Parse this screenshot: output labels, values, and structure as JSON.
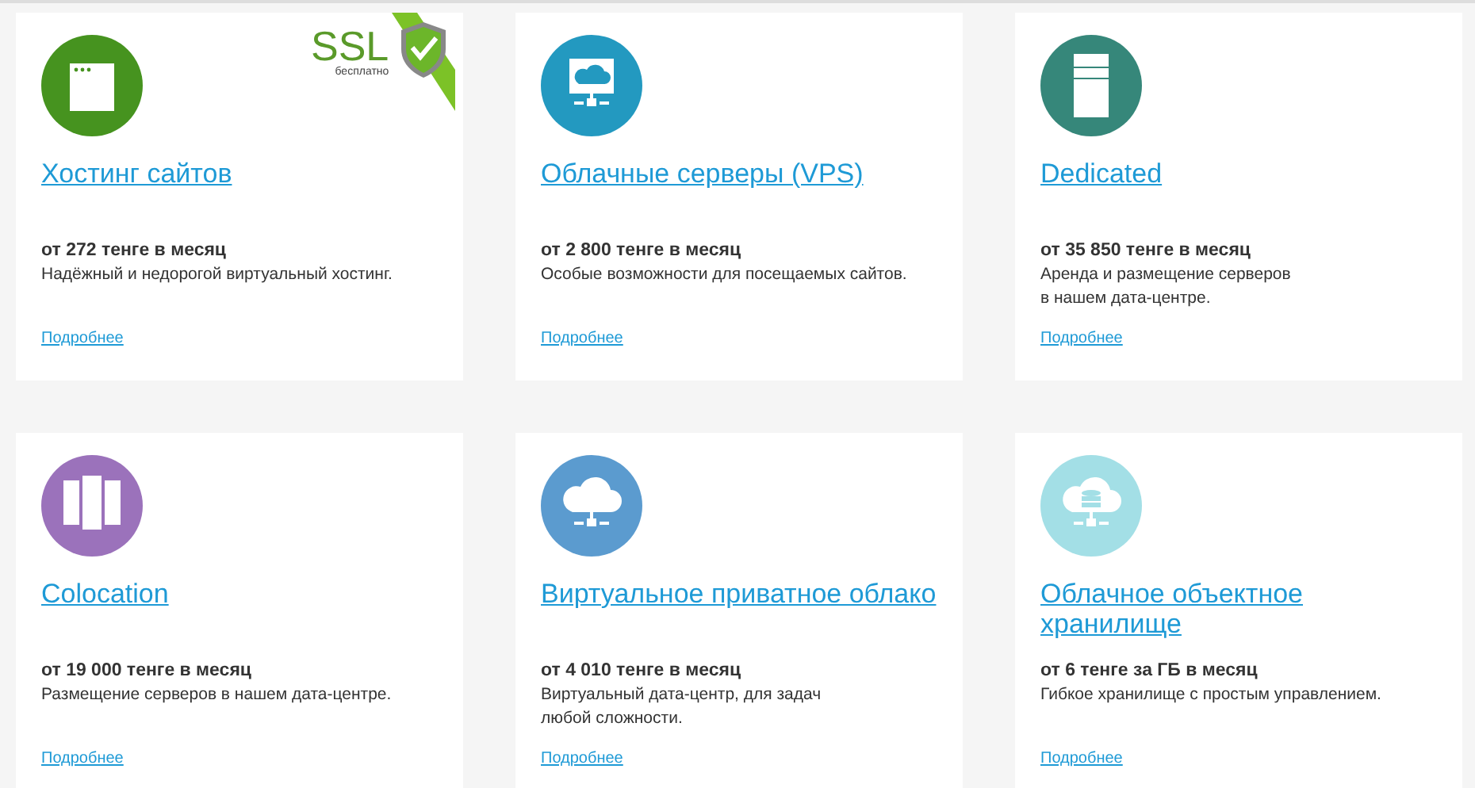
{
  "cards": [
    {
      "kind": "window",
      "color": "#46931f",
      "title": "Хостинг сайтов",
      "price": "от 272 тенге в месяц",
      "description": "Надёжный и недорогой виртуальный хостинг.",
      "link": "Подробнее",
      "badge": {
        "title": "SSL",
        "subtitle": "бесплатно"
      }
    },
    {
      "kind": "vps",
      "color": "#2399c0",
      "title": "Облачные серверы (VPS)",
      "price": "от 2 800 тенге в месяц",
      "description": "Особые возможности для посещаемых сайтов.",
      "link": "Подробнее"
    },
    {
      "kind": "dedicated",
      "color": "#36877a",
      "title": "Dedicated",
      "price": "от 35 850 тенге в месяц",
      "description": "Аренда и размещение серверов\nв нашем дата-центре.",
      "link": "Подробнее"
    },
    {
      "kind": "colocation",
      "color": "#9b72bb",
      "title": "Colocation",
      "price": "от 19 000 тенге в месяц",
      "description": "Размещение серверов в нашем дата-центре.",
      "link": "Подробнее"
    },
    {
      "kind": "cloud",
      "color": "#5b9bcf",
      "title": "Виртуальное приватное облако",
      "price": "от 4 010 тенге в месяц",
      "description": "Виртуальный дата-центр, для задач\nлюбой сложности.",
      "link": "Подробнее"
    },
    {
      "kind": "storage",
      "color": "#a3dfe6",
      "title": "Облачное объектное хранилище",
      "price": "от 6 тенге за ГБ в месяц",
      "description": "Гибкое хранилище с простым управлением.",
      "link": "Подробнее"
    }
  ]
}
